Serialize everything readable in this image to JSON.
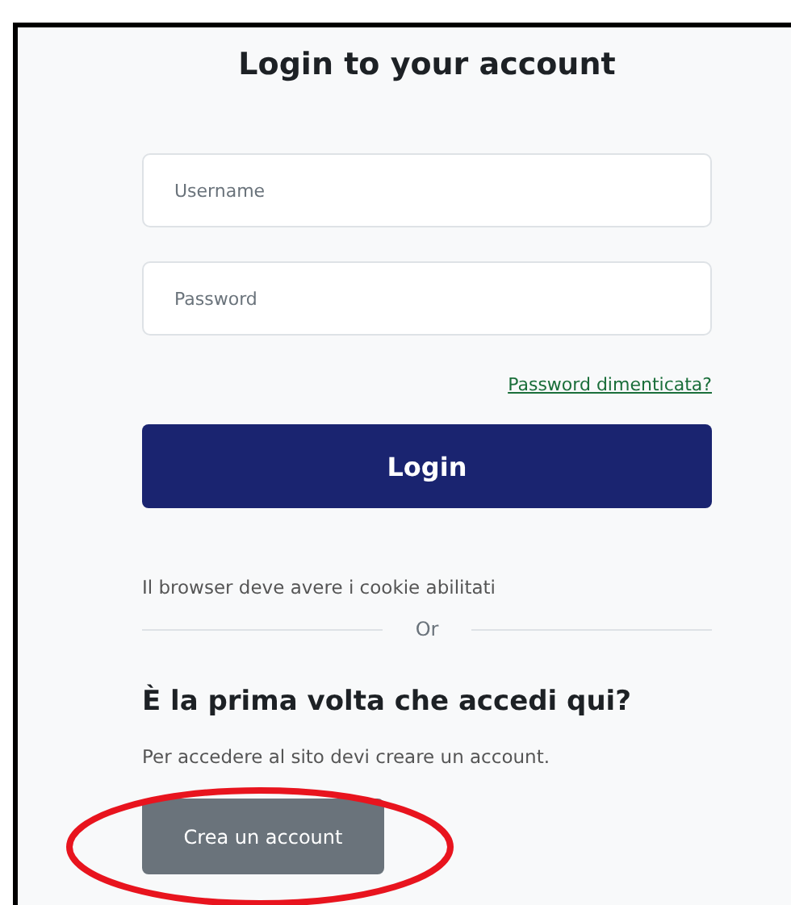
{
  "title": "Login to your account",
  "fields": [
    {
      "placeholder": "Username"
    },
    {
      "placeholder": "Password"
    }
  ],
  "forgot_link": "Password dimenticata?",
  "login_button": "Login",
  "cookie_notice": "Il browser deve avere i cookie abilitati",
  "divider_label": "Or",
  "signup": {
    "heading": "È la prima volta che accedi qui?",
    "text": "Per accedere al sito devi creare un account.",
    "button": "Crea un account"
  }
}
